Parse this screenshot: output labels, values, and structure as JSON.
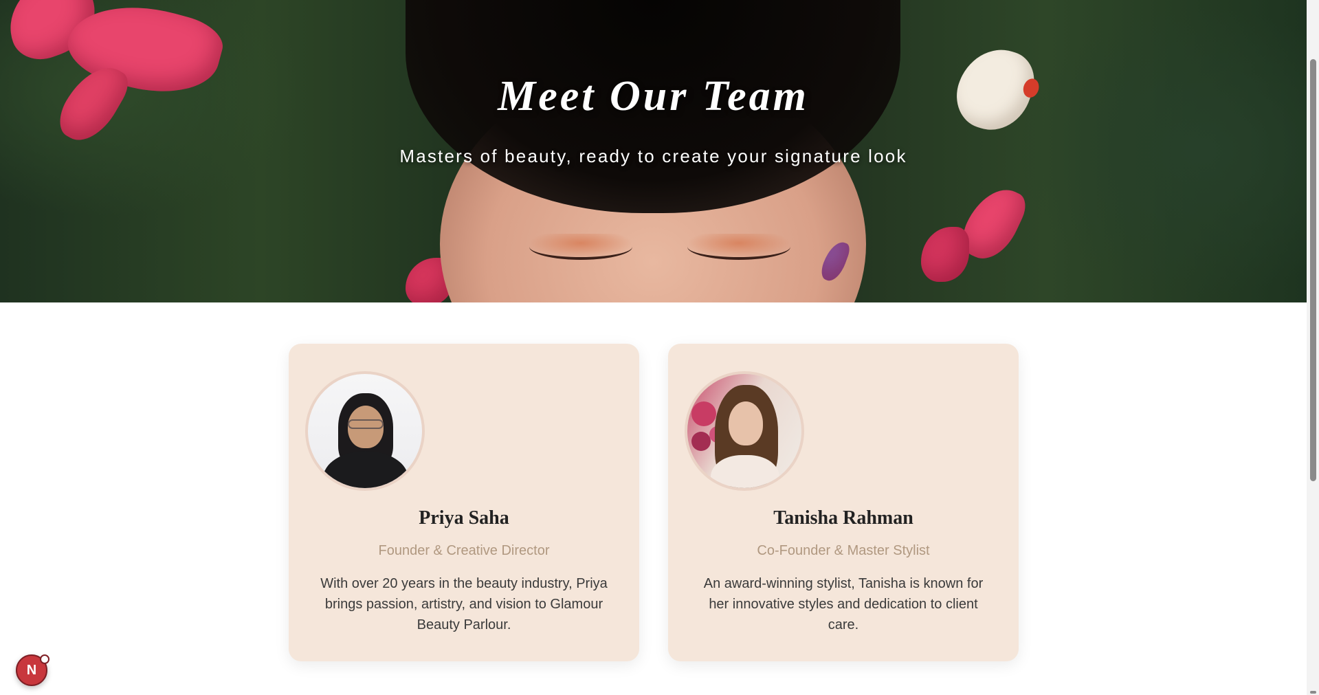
{
  "hero": {
    "title": "Meet Our Team",
    "subtitle": "Masters of beauty, ready to create your signature look"
  },
  "team": [
    {
      "name": "Priya Saha",
      "role": "Founder & Creative Director",
      "bio": "With over 20 years in the beauty industry, Priya brings passion, artistry, and vision to Glamour Beauty Parlour."
    },
    {
      "name": "Tanisha Rahman",
      "role": "Co-Founder & Master Stylist",
      "bio": "An award-winning stylist, Tanisha is known for her innovative styles and dedication to client care."
    }
  ],
  "floating_badge": {
    "letter": "N",
    "icon": "nextjs-dev-indicator-icon"
  },
  "colors": {
    "card_bg": "#f5e6da",
    "role_text": "#b09880",
    "avatar_border": "#ead3c6",
    "badge_bg": "#c8373d"
  }
}
